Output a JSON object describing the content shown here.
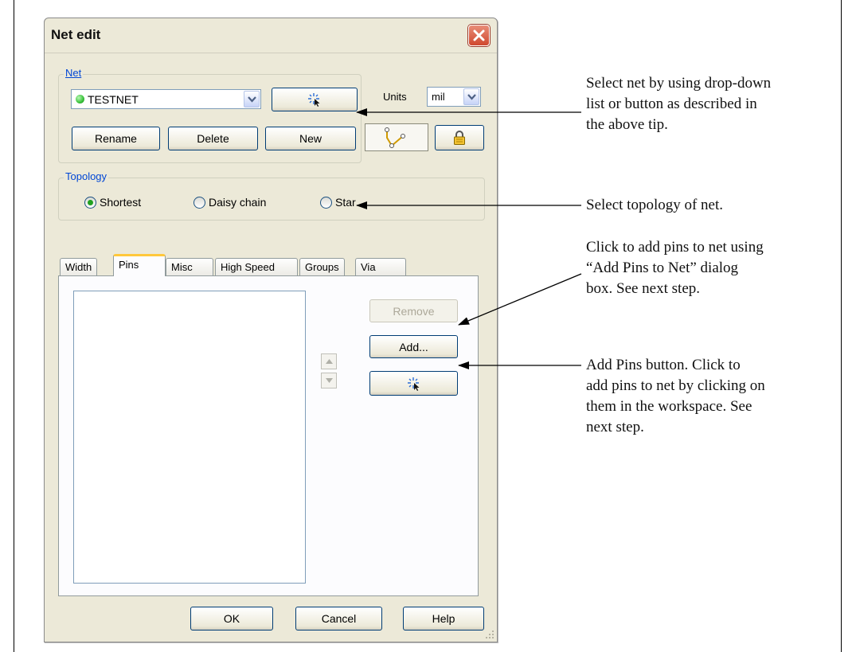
{
  "dialog": {
    "title": "Net edit",
    "close_icon": "close-x-icon"
  },
  "net_group": {
    "label": "Net",
    "net_combo_value": "TESTNET",
    "net_status_color": "#38c23a",
    "pick_icon": "pick-pointer-icon",
    "units_label": "Units",
    "units_value": "mil",
    "buttons": {
      "rename": "Rename",
      "delete": "Delete",
      "new": "New"
    },
    "topology_view_icon": "topology-view-icon",
    "lock_icon": "padlock-icon"
  },
  "topology_group": {
    "label": "Topology",
    "options": [
      {
        "label": "Shortest",
        "checked": true
      },
      {
        "label": "Daisy chain",
        "checked": false
      },
      {
        "label": "Star",
        "checked": false
      }
    ]
  },
  "tabs": [
    {
      "label": "Width",
      "active": false
    },
    {
      "label": "Pins",
      "active": true
    },
    {
      "label": "Misc",
      "active": false
    },
    {
      "label": "High Speed",
      "active": false
    },
    {
      "label": "Groups",
      "active": false
    },
    {
      "label": "Via",
      "active": false
    }
  ],
  "pins_tab": {
    "remove_button": "Remove",
    "add_button": "Add...",
    "add_pins_icon": "pick-pointer-icon",
    "move_up_icon": "arrow-up-icon",
    "move_down_icon": "arrow-down-icon"
  },
  "footer": {
    "ok": "OK",
    "cancel": "Cancel",
    "help": "Help"
  },
  "annotations": {
    "select_net": [
      "Select net by using drop-down",
      "list or button as described in",
      "the above tip."
    ],
    "select_topology": [
      "Select topology of net."
    ],
    "add_pins": [
      "Click to add pins to net using",
      "“Add Pins to Net” dialog",
      "box. See next step."
    ],
    "add_pins_button": [
      "Add Pins button. Click to",
      "add pins to net by clicking on",
      "them in the workspace. See",
      "next step."
    ]
  }
}
